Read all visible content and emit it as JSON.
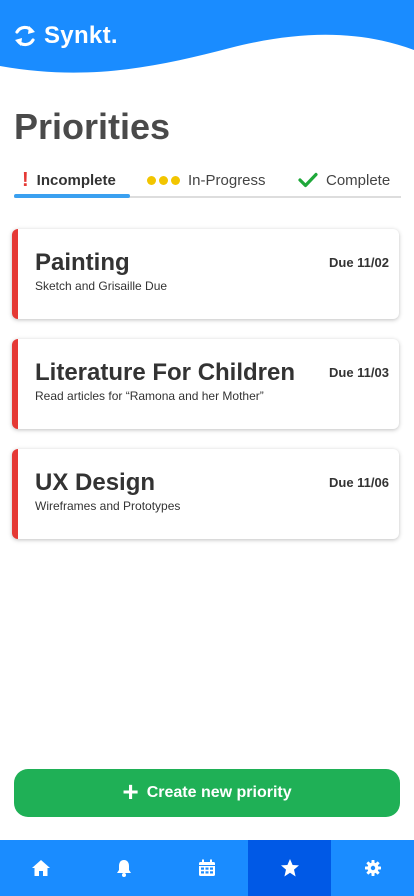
{
  "app": {
    "name": "Synkt."
  },
  "page": {
    "title": "Priorities"
  },
  "tabs": [
    {
      "label": "Incomplete",
      "icon": "exclamation-icon",
      "active": true
    },
    {
      "label": "In-Progress",
      "icon": "three-dots-icon",
      "active": false
    },
    {
      "label": "Complete",
      "icon": "checkmark-icon",
      "active": false
    }
  ],
  "priorities": [
    {
      "title": "Painting",
      "description": "Sketch and Grisaille Due",
      "due": "Due 11/02"
    },
    {
      "title": "Literature For Children",
      "description": "Read articles for “Ramona and her Mother”",
      "due": "Due 11/03"
    },
    {
      "title": "UX Design",
      "description": "Wireframes and Prototypes",
      "due": "Due 11/06"
    }
  ],
  "create_button": {
    "label": "Create new priority"
  },
  "nav": [
    {
      "icon": "home-icon",
      "active": false
    },
    {
      "icon": "bell-icon",
      "active": false
    },
    {
      "icon": "calendar-icon",
      "active": false
    },
    {
      "icon": "star-icon",
      "active": true
    },
    {
      "icon": "gear-icon",
      "active": false
    }
  ],
  "colors": {
    "header_blue": "#1a8cff",
    "nav_active": "#0059e6",
    "card_accent": "#e53935",
    "tab_underline": "#3aa0f0",
    "create_green": "#1fb056",
    "in_progress_yellow": "#f2c500",
    "complete_green": "#1fa83a"
  }
}
